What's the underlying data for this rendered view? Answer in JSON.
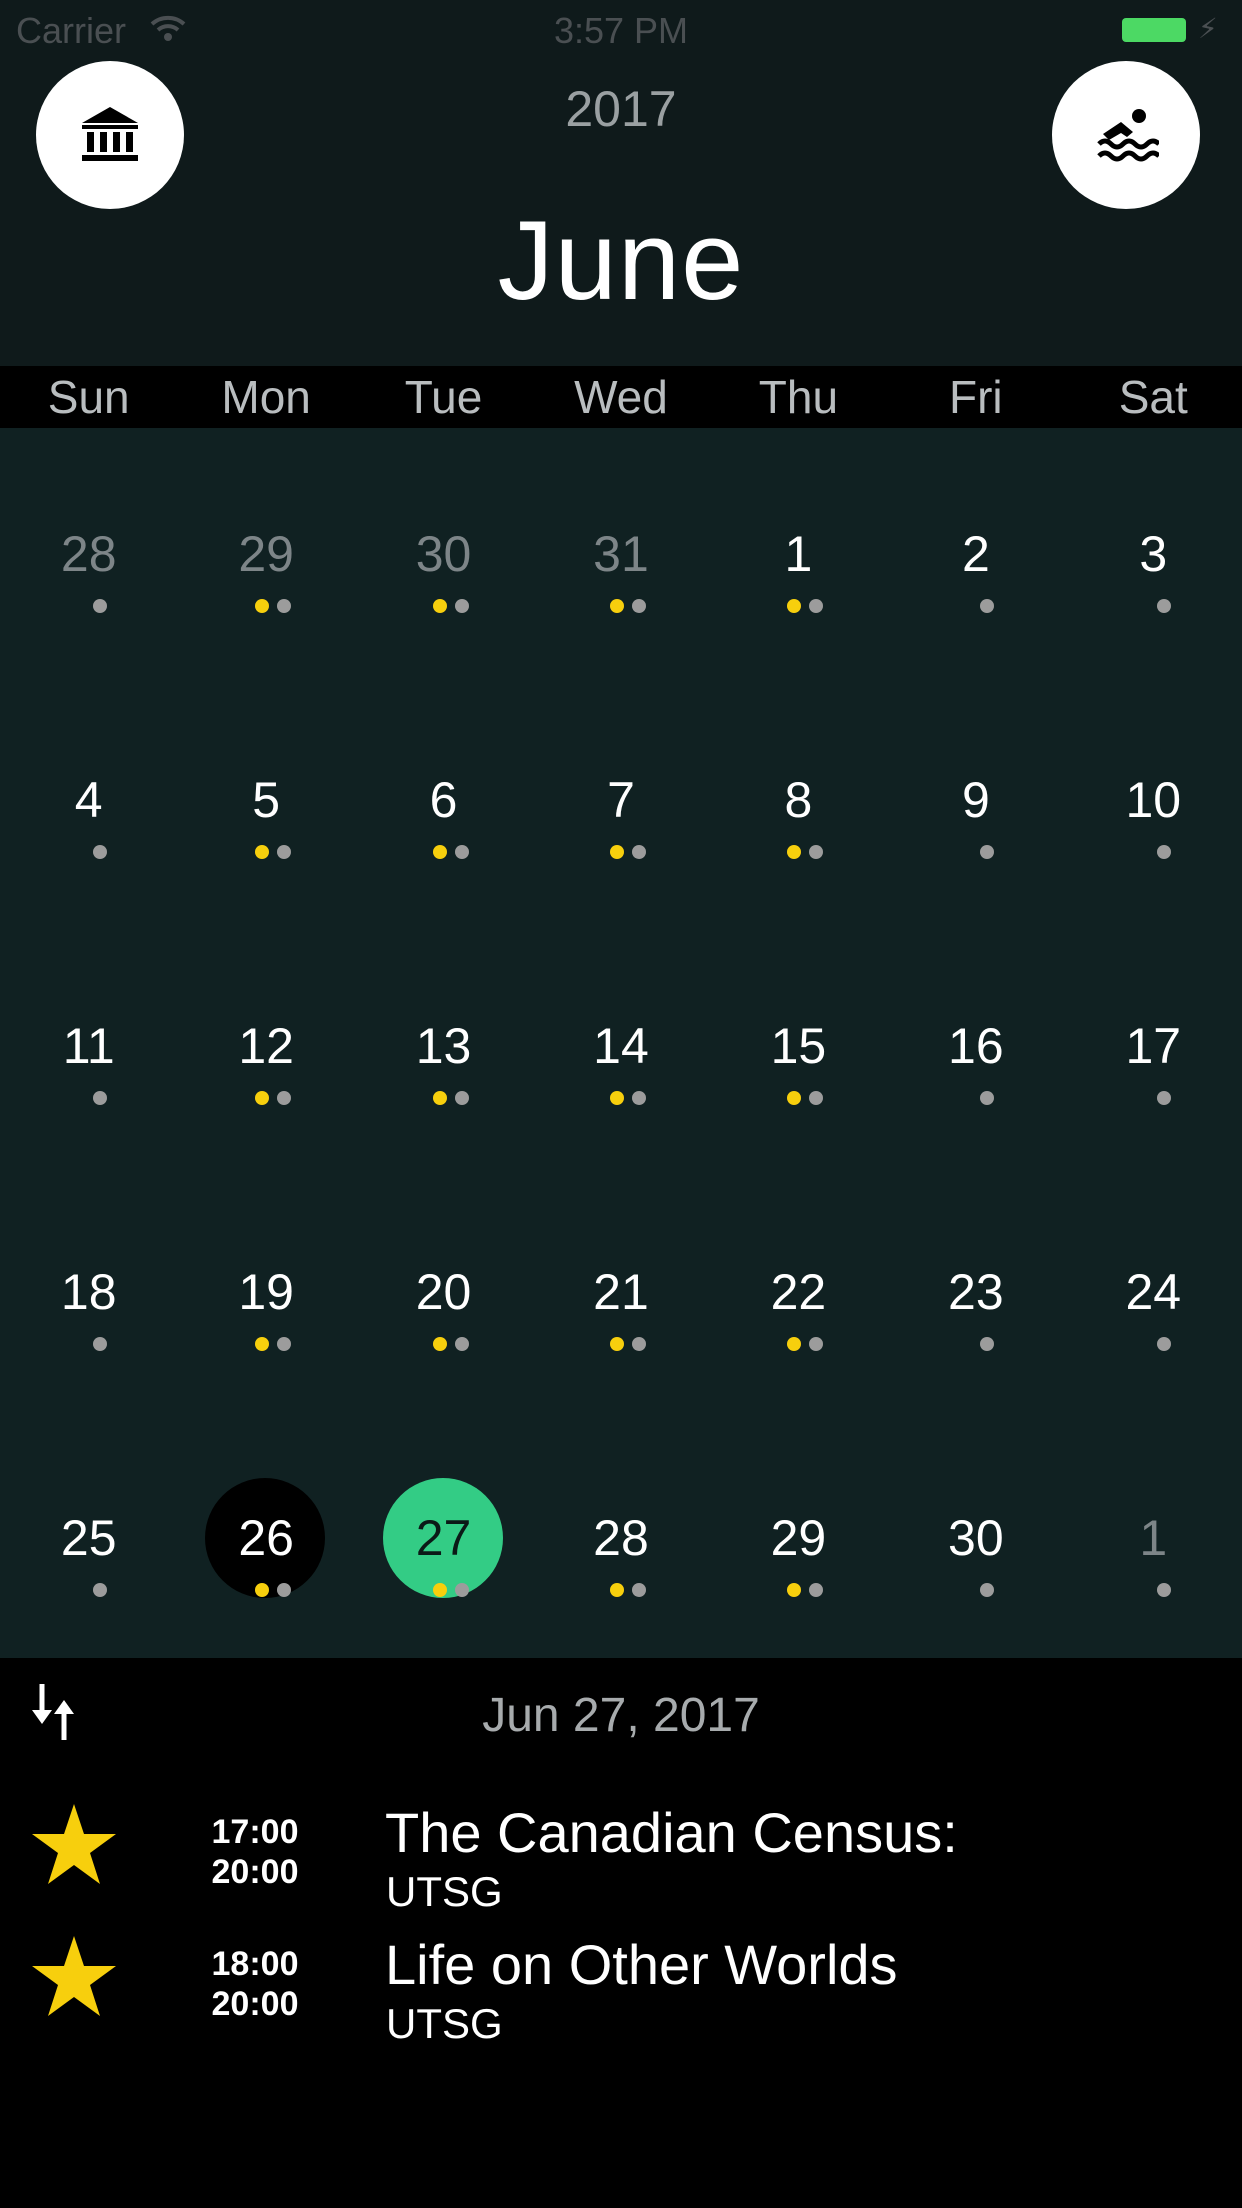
{
  "status_bar": {
    "carrier": "Carrier",
    "time": "3:57 PM"
  },
  "header": {
    "year": "2017",
    "month": "June",
    "left_button_icon": "bank-building-icon",
    "right_button_icon": "swimming-pool-icon"
  },
  "weekdays": [
    "Sun",
    "Mon",
    "Tue",
    "Wed",
    "Thu",
    "Fri",
    "Sat"
  ],
  "colors": {
    "header_bg": "#0f1a1b",
    "grid_bg": "#102122",
    "today_green": "#33cc85",
    "selected_black": "#000000",
    "dot_yellow": "#f7cf0d",
    "dot_gray": "#9c9c9c",
    "star_yellow": "#f7cf0d"
  },
  "calendar": {
    "weeks": [
      [
        {
          "label": "28",
          "other": true,
          "dots": [
            "g"
          ]
        },
        {
          "label": "29",
          "other": true,
          "dots": [
            "y",
            "g"
          ]
        },
        {
          "label": "30",
          "other": true,
          "dots": [
            "y",
            "g"
          ]
        },
        {
          "label": "31",
          "other": true,
          "dots": [
            "y",
            "g"
          ]
        },
        {
          "label": "1",
          "other": false,
          "dots": [
            "y",
            "g"
          ]
        },
        {
          "label": "2",
          "other": false,
          "dots": [
            "g"
          ]
        },
        {
          "label": "3",
          "other": false,
          "dots": [
            "g"
          ]
        }
      ],
      [
        {
          "label": "4",
          "other": false,
          "dots": [
            "g"
          ]
        },
        {
          "label": "5",
          "other": false,
          "dots": [
            "y",
            "g"
          ]
        },
        {
          "label": "6",
          "other": false,
          "dots": [
            "y",
            "g"
          ]
        },
        {
          "label": "7",
          "other": false,
          "dots": [
            "y",
            "g"
          ]
        },
        {
          "label": "8",
          "other": false,
          "dots": [
            "y",
            "g"
          ]
        },
        {
          "label": "9",
          "other": false,
          "dots": [
            "g"
          ]
        },
        {
          "label": "10",
          "other": false,
          "dots": [
            "g"
          ]
        }
      ],
      [
        {
          "label": "11",
          "other": false,
          "dots": [
            "g"
          ]
        },
        {
          "label": "12",
          "other": false,
          "dots": [
            "y",
            "g"
          ]
        },
        {
          "label": "13",
          "other": false,
          "dots": [
            "y",
            "g"
          ]
        },
        {
          "label": "14",
          "other": false,
          "dots": [
            "y",
            "g"
          ]
        },
        {
          "label": "15",
          "other": false,
          "dots": [
            "y",
            "g"
          ]
        },
        {
          "label": "16",
          "other": false,
          "dots": [
            "g"
          ]
        },
        {
          "label": "17",
          "other": false,
          "dots": [
            "g"
          ]
        }
      ],
      [
        {
          "label": "18",
          "other": false,
          "dots": [
            "g"
          ]
        },
        {
          "label": "19",
          "other": false,
          "dots": [
            "y",
            "g"
          ]
        },
        {
          "label": "20",
          "other": false,
          "dots": [
            "y",
            "g"
          ]
        },
        {
          "label": "21",
          "other": false,
          "dots": [
            "y",
            "g"
          ]
        },
        {
          "label": "22",
          "other": false,
          "dots": [
            "y",
            "g"
          ]
        },
        {
          "label": "23",
          "other": false,
          "dots": [
            "g"
          ]
        },
        {
          "label": "24",
          "other": false,
          "dots": [
            "g"
          ]
        }
      ],
      [
        {
          "label": "25",
          "other": false,
          "dots": [
            "g"
          ]
        },
        {
          "label": "26",
          "other": false,
          "dots": [
            "y",
            "g"
          ],
          "highlight": "selected"
        },
        {
          "label": "27",
          "other": false,
          "dots": [
            "y",
            "g"
          ],
          "highlight": "today"
        },
        {
          "label": "28",
          "other": false,
          "dots": [
            "y",
            "g"
          ]
        },
        {
          "label": "29",
          "other": false,
          "dots": [
            "y",
            "g"
          ]
        },
        {
          "label": "30",
          "other": false,
          "dots": [
            "g"
          ]
        },
        {
          "label": "1",
          "other": true,
          "dots": [
            "g"
          ]
        }
      ]
    ]
  },
  "events_panel": {
    "date": "Jun 27, 2017",
    "sort_icon": "sort-arrows-icon",
    "events": [
      {
        "start": "17:00",
        "end": "20:00",
        "title": "The Canadian Census:",
        "location": "UTSG",
        "starred": true
      },
      {
        "start": "18:00",
        "end": "20:00",
        "title": "Life on Other Worlds",
        "location": "UTSG",
        "starred": true
      }
    ]
  }
}
